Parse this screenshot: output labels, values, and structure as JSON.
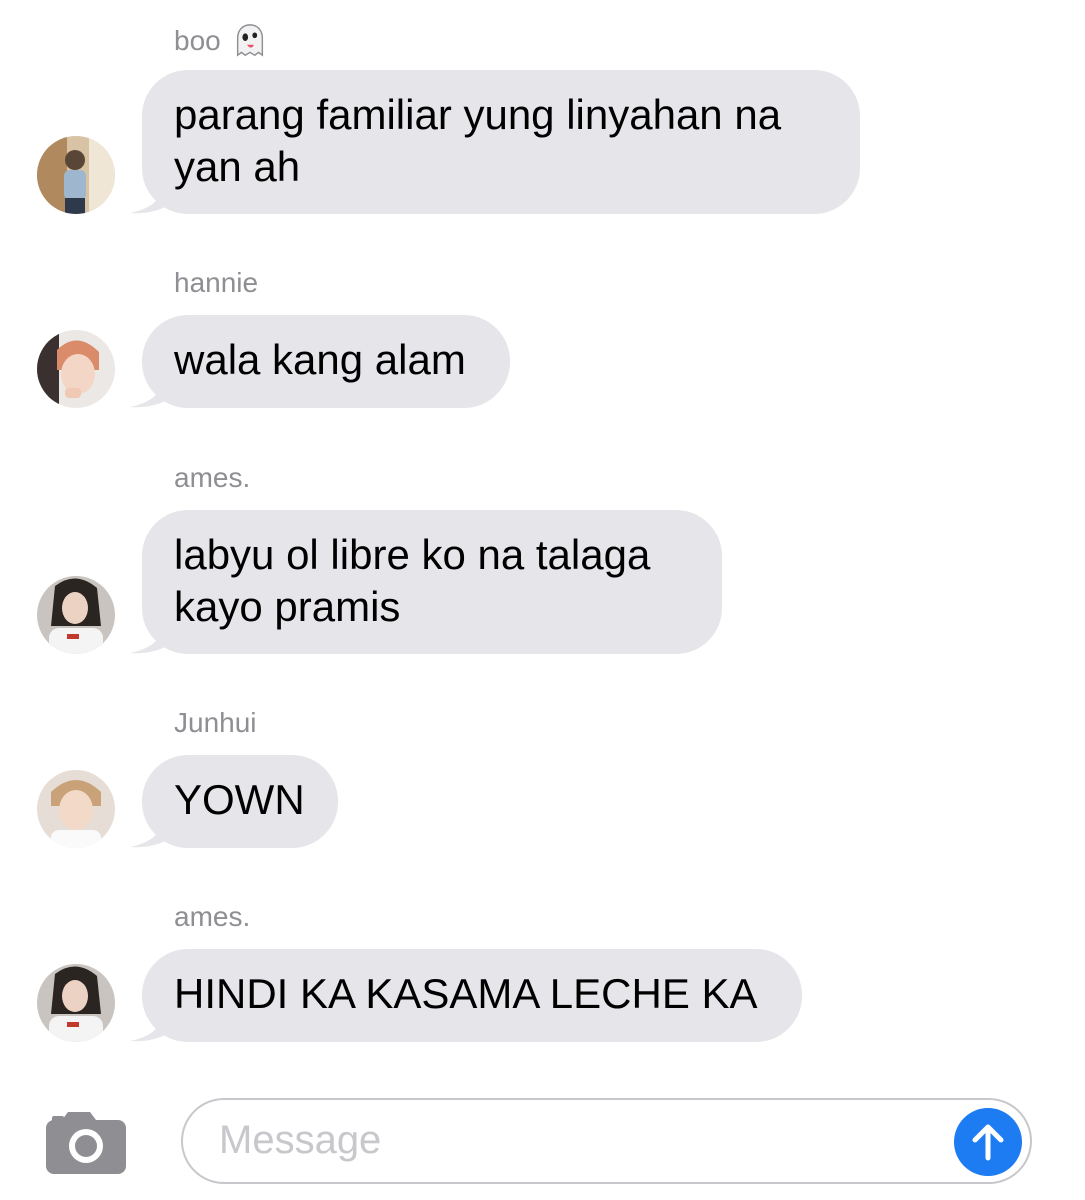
{
  "messages": [
    {
      "sender": "boo",
      "sender_icon": "ghost-emoji",
      "text_lines": [
        "parang familiar yung linyahan na",
        "yan ah"
      ]
    },
    {
      "sender": "hannie",
      "text_lines": [
        "wala kang alam"
      ]
    },
    {
      "sender": "ames.",
      "text_lines": [
        "labyu ol libre ko na talaga",
        "kayo pramis"
      ]
    },
    {
      "sender": "Junhui",
      "text_lines": [
        "YOWN"
      ]
    },
    {
      "sender": "ames.",
      "text_lines": [
        "HINDI KA KASAMA LECHE KA"
      ]
    }
  ],
  "input": {
    "placeholder": "Message",
    "camera_icon": "camera-icon",
    "send_icon": "arrow-up-icon"
  },
  "colors": {
    "bubble": "#e5e5ea",
    "sender_text": "#8e8e93",
    "send_button": "#1d7cf2",
    "placeholder": "#c7c7cc"
  }
}
